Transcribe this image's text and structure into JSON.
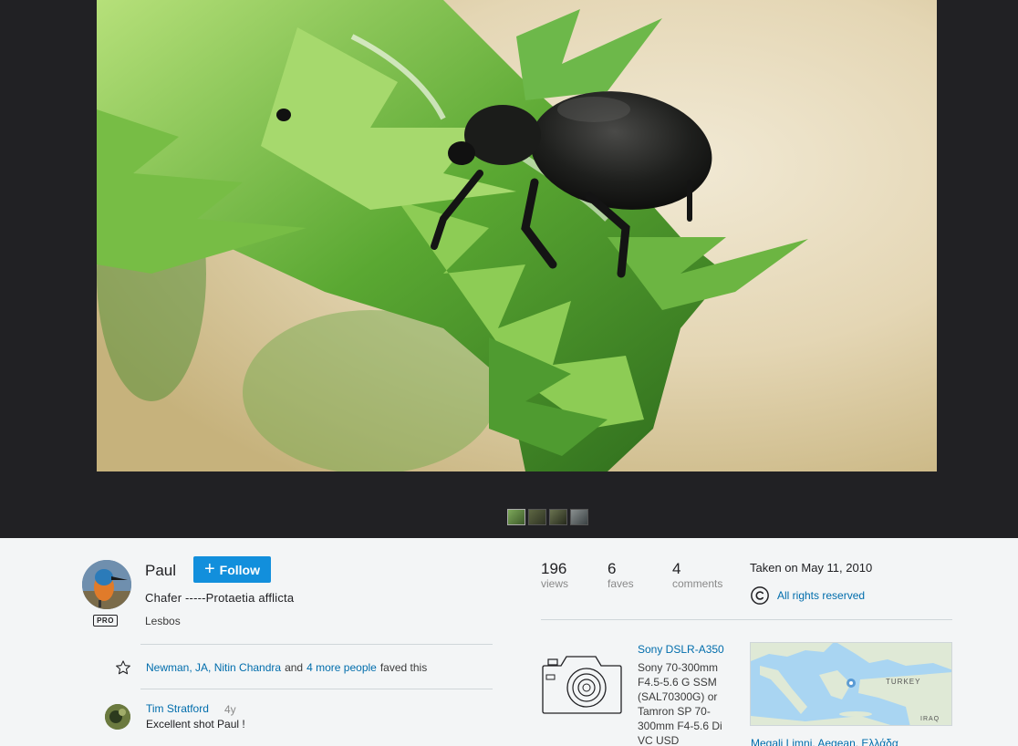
{
  "owner": {
    "name": "Paul",
    "badge": "PRO",
    "follow_label": "Follow"
  },
  "photo": {
    "title": "Chafer -----Protaetia afflicta",
    "description": "Lesbos"
  },
  "faves": {
    "people": [
      "Newman, JA",
      "Nitin Chandra"
    ],
    "joiner": "and",
    "more_link": "4 more people",
    "suffix": "faved this"
  },
  "comments": [
    {
      "author": "Tim Stratford",
      "age": "4y",
      "text": "Excellent shot Paul !"
    }
  ],
  "stats": [
    {
      "value": "196",
      "label": "views"
    },
    {
      "value": "6",
      "label": "faves"
    },
    {
      "value": "4",
      "label": "comments"
    }
  ],
  "taken": "Taken on May 11, 2010",
  "license": "All rights reserved",
  "exif": {
    "camera": "Sony DSLR-A350",
    "lens": "Sony 70-300mm F4.5-5.6 G SSM (SAL70300G) or Tamron SP 70-300mm F4-5.6 Di VC USD"
  },
  "map": {
    "labels": [
      "TURKEY",
      "IRAQ"
    ]
  },
  "location": "Megali Limni, Aegean, Ελλάδα",
  "colors": {
    "accent": "#128fdc",
    "link": "#006dac",
    "dark_bg": "#212124"
  },
  "icons": [
    "plus-icon",
    "star-icon",
    "copyright-icon",
    "camera-icon",
    "map-pin-icon"
  ]
}
